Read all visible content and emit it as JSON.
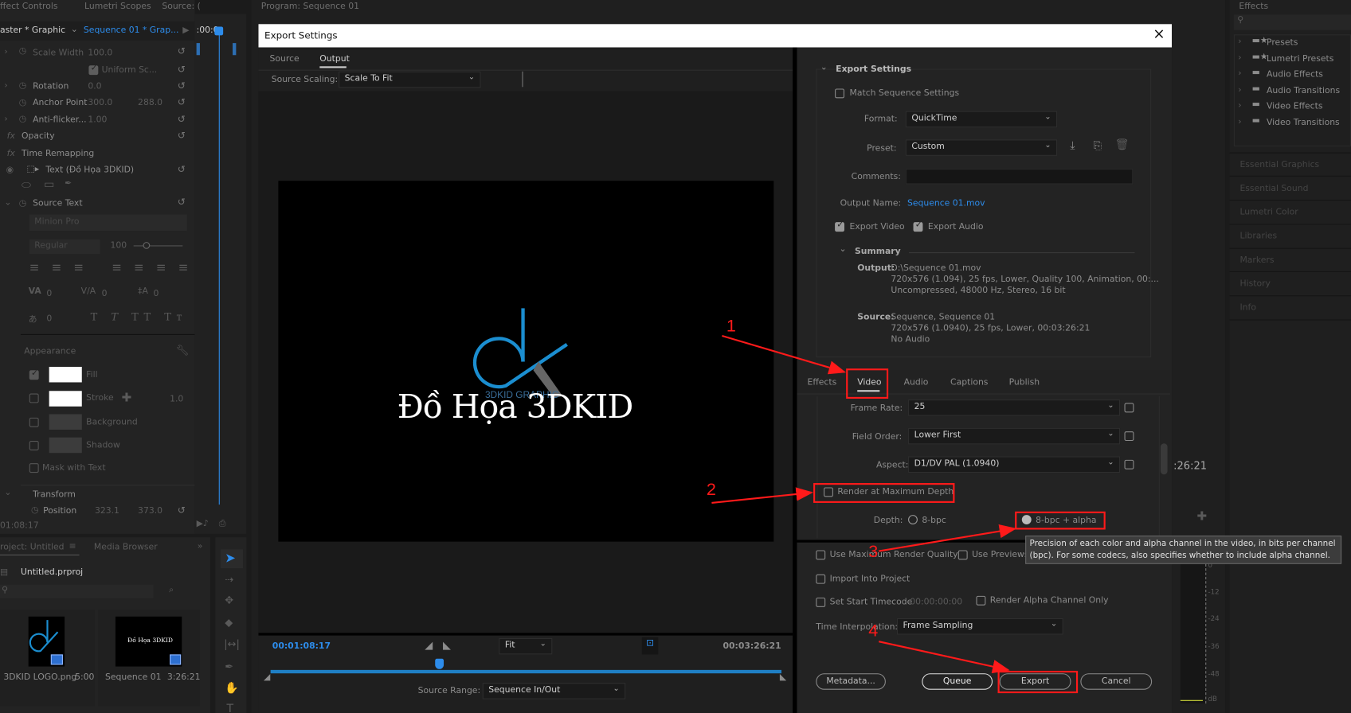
{
  "left_panel": {
    "tabs": [
      "ffect Controls",
      "Lumetri Scopes",
      "Source: ("
    ],
    "master_clip": "aster * Graphic",
    "sequence_clip": "Sequence 01 * Grap...",
    "timeline_time": ":00:0",
    "properties": [
      {
        "name": "Scale Width",
        "v1": "100.0",
        "v2": ""
      },
      {
        "name": "Uniform Sc...",
        "v1": "",
        "v2": ""
      },
      {
        "name": "Rotation",
        "v1": "0.0",
        "v2": ""
      },
      {
        "name": "Anchor Point",
        "v1": "300.0",
        "v2": "288.0"
      },
      {
        "name": "Anti-flicker...",
        "v1": "1.00",
        "v2": ""
      }
    ],
    "opacity": "Opacity",
    "time_remapping": "Time Remapping",
    "text_layer": "Text (Đồ Họa 3DKID)",
    "source_text": "Source Text",
    "font": "Minion Pro",
    "font_style": "Regular",
    "font_size": "100",
    "tracking": [
      "0",
      "0",
      "0",
      "0"
    ],
    "appearance": "Appearance",
    "appearance_items": [
      {
        "label": "Fill",
        "checked": true
      },
      {
        "label": "Stroke",
        "checked": false,
        "value": "1.0"
      },
      {
        "label": "Background",
        "checked": false
      },
      {
        "label": "Shadow",
        "checked": false
      }
    ],
    "mask_with_text": "Mask with Text",
    "transform": "Transform",
    "position": {
      "label": "Position",
      "x": "323.1",
      "y": "373.0"
    },
    "timecode": "01:08:17"
  },
  "project_panel": {
    "tabs": [
      "roject: Untitled",
      "Media Browser"
    ],
    "file": "Untitled.prproj",
    "items": [
      {
        "name": "3DKID LOGO.png",
        "duration": "5:00"
      },
      {
        "name": "Sequence 01",
        "duration": "3:26:21",
        "thumb_text": "Đồ Họa 3DKID"
      }
    ]
  },
  "program_monitor": {
    "title": "Program: Sequence 01",
    "timecode_tail": ":26:21",
    "meter_labels": [
      "0",
      "-12",
      "-24",
      "-36",
      "-48",
      "dB"
    ]
  },
  "effects_panel": {
    "title": "Effects",
    "items": [
      "Presets",
      "Lumetri Presets",
      "Audio Effects",
      "Audio Transitions",
      "Video Effects",
      "Video Transitions"
    ],
    "collapsed": [
      "Essential Graphics",
      "Essential Sound",
      "Lumetri Color",
      "Libraries",
      "Markers",
      "History",
      "Info"
    ]
  },
  "dialog": {
    "title": "Export Settings",
    "close": "×",
    "preview_tabs": [
      "Source",
      "Output"
    ],
    "active_preview_tab": "Output",
    "source_scaling_label": "Source Scaling:",
    "source_scaling": "Scale To Fit",
    "preview_text": "Đồ Họa 3DKID",
    "logo_text": "3DKID GRAPHIC",
    "current_time": "00:01:08:17",
    "duration": "00:03:26:21",
    "zoom": "Fit",
    "playhead_fraction": 0.33,
    "source_range_label": "Source Range:",
    "source_range": "Sequence In/Out",
    "export_settings": {
      "header": "Export Settings",
      "match_sequence": "Match Sequence Settings",
      "format_label": "Format:",
      "format": "QuickTime",
      "preset_label": "Preset:",
      "preset": "Custom",
      "comments_label": "Comments:",
      "comments": "",
      "output_name_label": "Output Name:",
      "output_name": "Sequence 01.mov",
      "export_video": "Export Video",
      "export_audio": "Export Audio",
      "summary": "Summary",
      "output_label": "Output:",
      "output_lines": [
        "D:\\Sequence 01.mov",
        "720x576 (1.094), 25 fps, Lower, Quality 100, Animation, 00:...",
        "Uncompressed, 48000 Hz, Stereo, 16 bit"
      ],
      "source_label": "Source:",
      "source_lines": [
        "Sequence, Sequence 01",
        "720x576 (1.0940), 25 fps, Lower, 00:03:26:21",
        "No Audio"
      ]
    },
    "tabs": [
      "Effects",
      "Video",
      "Audio",
      "Captions",
      "Publish"
    ],
    "active_tab": "Video",
    "video": {
      "frame_rate_label": "Frame Rate:",
      "frame_rate": "25",
      "field_order_label": "Field Order:",
      "field_order": "Lower First",
      "aspect_label": "Aspect:",
      "aspect": "D1/DV PAL (1.0940)",
      "render_max_depth": "Render at Maximum Depth",
      "depth_label": "Depth:",
      "depth_options": [
        "8-bpc",
        "8-bpc + alpha"
      ]
    },
    "tooltip": [
      "Precision of each color and alpha channel in the video, in bits per channel",
      "(bpc). For some codecs, also specifies whether to include alpha channel."
    ],
    "options": {
      "max_render_quality": "Use Maximum Render Quality",
      "use_previews": "Use Previews",
      "import_into_project": "Import Into Project",
      "set_start_timecode": "Set Start Timecode",
      "start_timecode": "00:00:00:00",
      "render_alpha_only": "Render Alpha Channel Only",
      "time_interpolation_label": "Time Interpolation:",
      "time_interpolation": "Frame Sampling"
    },
    "buttons": {
      "metadata": "Metadata...",
      "queue": "Queue",
      "export": "Export",
      "cancel": "Cancel"
    }
  },
  "annotations": [
    "1",
    "2",
    "3",
    "4"
  ],
  "colors": {
    "accent": "#2d8ceb",
    "annotation": "#ff1a1a",
    "logo_blue": "#1b8ed0"
  }
}
